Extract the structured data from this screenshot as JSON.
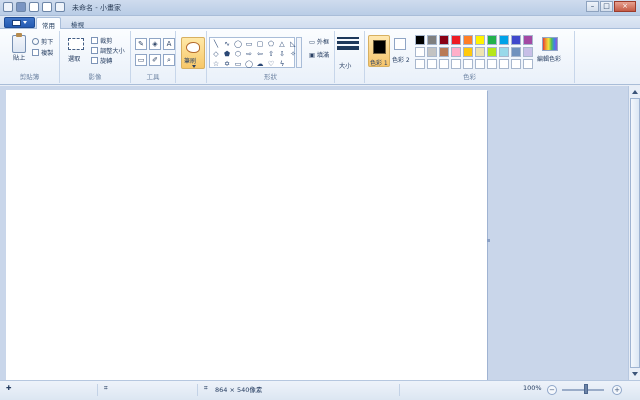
{
  "window": {
    "title": "未命名 - 小畫家"
  },
  "tabs": [
    "常用",
    "檢視"
  ],
  "clipboard": {
    "paste_label": "貼上",
    "cut_label": "剪下",
    "copy_label": "複製",
    "group_label": "剪貼簿"
  },
  "image": {
    "select_label": "選取",
    "crop_label": "裁剪",
    "resize_label": "調整大小",
    "rotate_label": "旋轉",
    "group_label": "影像"
  },
  "tools": {
    "group_label": "工具",
    "pencil": "pencil-icon",
    "fill": "fill-icon",
    "text": "text-icon",
    "eraser": "eraser-icon",
    "picker": "color-picker-icon",
    "magnifier": "magnifier-icon"
  },
  "brushes": {
    "label": "筆刷"
  },
  "shapes": {
    "group_label": "形狀",
    "outline_label": "外框",
    "fill_label": "填滿"
  },
  "size": {
    "label": "大小"
  },
  "colors": {
    "group_label": "色彩",
    "color1_label": "色彩 1",
    "color2_label": "色彩 2",
    "edit_label": "編輯色彩",
    "palette": [
      "#000000",
      "#7f7f7f",
      "#880015",
      "#ed1c24",
      "#ff7f27",
      "#fff200",
      "#22b14c",
      "#00a2e8",
      "#3f48cc",
      "#a349a4",
      "#ffffff",
      "#c3c3c3",
      "#b97a57",
      "#ffaec9",
      "#ffc90e",
      "#efe4b0",
      "#b5e61d",
      "#99d9ea",
      "#7092be",
      "#c8bfe7",
      "#ffffff",
      "#ffffff",
      "#ffffff",
      "#ffffff",
      "#ffffff",
      "#ffffff",
      "#ffffff",
      "#ffffff",
      "#ffffff",
      "#ffffff"
    ]
  },
  "status": {
    "dimensions": "864 × 540像素",
    "zoom": "100%"
  }
}
